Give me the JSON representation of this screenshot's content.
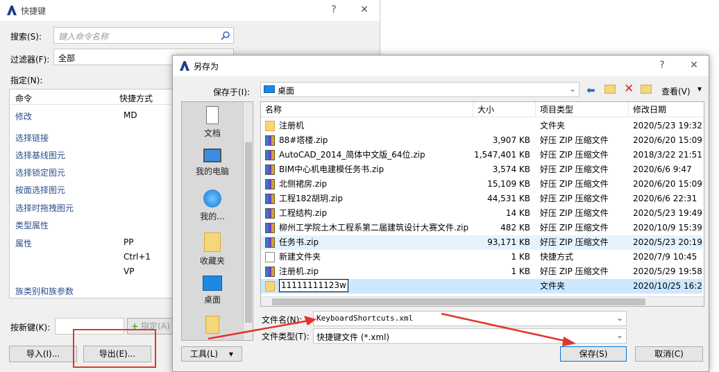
{
  "bg": {
    "title": "快捷键",
    "search_label": "搜索(S):",
    "search_placeholder": "键入命令名称",
    "filter_label": "过滤器(F):",
    "filter_value": "全部",
    "assign_label": "指定(N):",
    "col_command": "命令",
    "col_shortcut": "快捷方式",
    "rows": [
      {
        "cmd": "修改",
        "key": "MD"
      },
      {
        "cmd": "选择链接",
        "key": ""
      },
      {
        "cmd": "选择基线图元",
        "key": ""
      },
      {
        "cmd": "选择锁定图元",
        "key": ""
      },
      {
        "cmd": "按面选择图元",
        "key": ""
      },
      {
        "cmd": "选择时拖拽图元",
        "key": ""
      },
      {
        "cmd": "类型属性",
        "key": ""
      },
      {
        "cmd": "属性",
        "key": "PP"
      },
      {
        "cmd": "",
        "key": "Ctrl+1"
      },
      {
        "cmd": "",
        "key": "VP"
      },
      {
        "cmd": "族类别和族参数",
        "key": ""
      }
    ],
    "new_key_label": "按新键(K):",
    "assign_button": "指定(A)",
    "import_button": "导入(I)...",
    "export_button": "导出(E)..."
  },
  "dlg": {
    "title": "另存为",
    "help": "?",
    "close": "✕",
    "save_in_label": "保存于(I):",
    "save_in_value": "桌面",
    "view_label": "查看(V)",
    "places": [
      "文档",
      "我的电脑",
      "我的...",
      "收藏夹",
      "桌面"
    ],
    "columns": {
      "name": "名称",
      "size": "大小",
      "type": "项目类型",
      "date": "修改日期"
    },
    "files": [
      {
        "name": "注册机",
        "size": "",
        "type": "文件夹",
        "date": "2020/5/23 19:32",
        "icon": "folder"
      },
      {
        "name": "88#塔楼.zip",
        "size": "3,907 KB",
        "type": "好压 ZIP 压缩文件",
        "date": "2020/6/20 15:09",
        "icon": "zip"
      },
      {
        "name": "AutoCAD_2014_简体中文版_64位.zip",
        "size": "1,547,401 KB",
        "type": "好压 ZIP 压缩文件",
        "date": "2018/3/22 21:51",
        "icon": "zip"
      },
      {
        "name": "BIM中心机电建模任务书.zip",
        "size": "3,574 KB",
        "type": "好压 ZIP 压缩文件",
        "date": "2020/6/6 9:47",
        "icon": "zip"
      },
      {
        "name": "北侧裙房.zip",
        "size": "15,109 KB",
        "type": "好压 ZIP 压缩文件",
        "date": "2020/6/20 15:09",
        "icon": "zip"
      },
      {
        "name": "工程182胡玥.zip",
        "size": "44,531 KB",
        "type": "好压 ZIP 压缩文件",
        "date": "2020/6/6 22:31",
        "icon": "zip"
      },
      {
        "name": "工程结构.zip",
        "size": "14 KB",
        "type": "好压 ZIP 压缩文件",
        "date": "2020/5/23 19:49",
        "icon": "zip"
      },
      {
        "name": "柳州工学院土木工程系第二届建筑设计大赛文件.zip",
        "size": "482 KB",
        "type": "好压 ZIP 压缩文件",
        "date": "2020/10/9 15:39",
        "icon": "zip"
      },
      {
        "name": "任务书.zip",
        "size": "93,171 KB",
        "type": "好压 ZIP 压缩文件",
        "date": "2020/5/23 20:19",
        "icon": "zip"
      },
      {
        "name": "新建文件夹",
        "size": "1 KB",
        "type": "快捷方式",
        "date": "2020/7/9 10:45",
        "icon": "lnk"
      },
      {
        "name": "注册机.zip",
        "size": "1 KB",
        "type": "好压 ZIP 压缩文件",
        "date": "2020/5/29 19:58",
        "icon": "zip"
      },
      {
        "name": "11111111123w",
        "size": "",
        "type": "文件夹",
        "date": "2020/10/25 16:2",
        "icon": "folder"
      }
    ],
    "filename_label": "文件名(N):",
    "filename_value": "KeyboardShortcuts.xml",
    "filetype_label": "文件类型(T):",
    "filetype_value": "快捷键文件 (*.xml)",
    "tools_button": "工具(L)",
    "save_button": "保存(S)",
    "cancel_button": "取消(C)"
  },
  "colors": {
    "accent": "#0078d7",
    "highlight": "#e0352b",
    "selected_row": "#cce8ff"
  }
}
